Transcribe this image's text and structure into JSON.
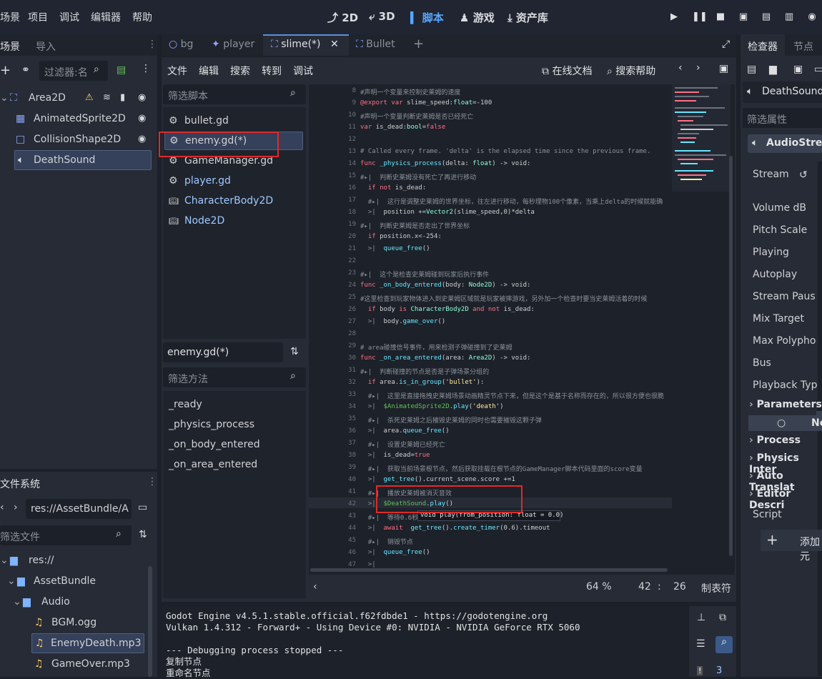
{
  "menubar": {
    "items": [
      "场景",
      "项目",
      "调试",
      "编辑器",
      "帮助"
    ],
    "modes": [
      "2D",
      "3D",
      "脚本",
      "游戏",
      "资产库"
    ]
  },
  "scene_dock": {
    "tabs": [
      "场景",
      "导入"
    ],
    "filter_placeholder": "过滤器:名",
    "nodes": [
      "Area2D",
      "AnimatedSprite2D",
      "CollisionShape2D",
      "DeathSound"
    ]
  },
  "fs_dock": {
    "title": "文件系统",
    "path": "res://AssetBundle/A",
    "filter_placeholder": "筛选文件",
    "items": [
      "res://",
      "AssetBundle",
      "Audio",
      "BGM.ogg",
      "EnemyDeath.mp3",
      "GameOver.mp3"
    ]
  },
  "editor_tabs": [
    "bg",
    "player",
    "slime(*)",
    "Bullet"
  ],
  "script_menu": [
    "文件",
    "编辑",
    "搜索",
    "转到",
    "调试"
  ],
  "script_links": [
    "在线文档",
    "搜索帮助"
  ],
  "script_list": {
    "filter_placeholder": "筛选脚本",
    "items": [
      "bullet.gd",
      "enemy.gd(*)",
      "GameManager.gd",
      "player.gd",
      "CharacterBody2D",
      "Node2D"
    ]
  },
  "method_panel": {
    "current": "enemy.gd(*)",
    "filter_placeholder": "筛选方法",
    "items": [
      "_ready",
      "_physics_process",
      "_on_body_entered",
      "_on_area_entered"
    ]
  },
  "code_lines": [
    {
      "n": "8",
      "t": "#声明一个变量来控制史莱姆的速度"
    },
    {
      "n": "9",
      "t": "@export var slime_speed:float=-100"
    },
    {
      "n": "10",
      "t": "#声明一个变量判断史莱姆是否已经死亡"
    },
    {
      "n": "11",
      "t": "var is_dead:bool=false"
    },
    {
      "n": "12",
      "t": ""
    },
    {
      "n": "13",
      "t": "# Called every frame. 'delta' is the elapsed time since the previous frame."
    },
    {
      "n": "14",
      "t": "func _physics_process(delta: float) -> void:"
    },
    {
      "n": "15",
      "t": "#▸|  判断史莱姆没有死亡了再进行移动"
    },
    {
      "n": "16",
      "t": "  if not is_dead:"
    },
    {
      "n": "17",
      "t": "  #▸|  这行是调整史莱姆的世界坐标，往左进行移动，每秒理物100个像素，当乘上delta的时候就能确"
    },
    {
      "n": "18",
      "t": "  >|  position +=Vector2(slime_speed,0)*delta"
    },
    {
      "n": "19",
      "t": "#▸|  判断史莱姆是否走出了世界坐标"
    },
    {
      "n": "20",
      "t": "  if position.x<-254:"
    },
    {
      "n": "21",
      "t": "  >|  queue_free()"
    },
    {
      "n": "22",
      "t": ""
    },
    {
      "n": "23",
      "t": "#▸|  这个是检查史莱姆碰到玩家后执行事件"
    },
    {
      "n": "24",
      "t": "func _on_body_entered(body: Node2D) -> void:"
    },
    {
      "n": "25",
      "t": "#这里检查到玩家物体进入到史莱姆区域就是玩家被摔游戏，另外加一个检查时要当史莱姆活着的时候"
    },
    {
      "n": "26",
      "t": "  if body is CharacterBody2D and not is_dead:"
    },
    {
      "n": "27",
      "t": "  >|  body.game_over()"
    },
    {
      "n": "28",
      "t": ""
    },
    {
      "n": "29",
      "t": "# area碰撞信号事件，用来检测子弹碰撞到了史莱姆"
    },
    {
      "n": "30",
      "t": "func _on_area_entered(area: Area2D) -> void:"
    },
    {
      "n": "31",
      "t": "#▸|  判断碰撞的节点是否是子弹场景分组的"
    },
    {
      "n": "32",
      "t": "  if area.is_in_group('bullet'):"
    },
    {
      "n": "33",
      "t": "  #▸|  这里是直接拖拽史莱姆场景动画精灵节点下来，但是这个是基于名称而存在的，所以很方便也很脆"
    },
    {
      "n": "34",
      "t": "  >|  $AnimatedSprite2D.play('death')"
    },
    {
      "n": "35",
      "t": "  #▸|  杀死史莱姆之后摧毁史莱姆的同时也需要摧毁这颗子弹"
    },
    {
      "n": "36",
      "t": "  >|  area.queue_free()"
    },
    {
      "n": "37",
      "t": "  #▸|  设置史莱姆已经死亡"
    },
    {
      "n": "38",
      "t": "  >|  is_dead=true"
    },
    {
      "n": "39",
      "t": "  #▸|  获取当前场景根节点，然后获取挂载在根节点的GameManager脚本代码里面的score变量"
    },
    {
      "n": "40",
      "t": "  >|  get_tree().current_scene.score +=1"
    },
    {
      "n": "41",
      "t": "  #▸|  播放史莱姆被消灭音效"
    },
    {
      "n": "42",
      "t": "  >|  $DeathSound.play()"
    },
    {
      "n": "43",
      "t": "  #▸|  等待0.6秒"
    },
    {
      "n": "44",
      "t": "  >|  await  get_tree().create_timer(0.6).timeout"
    },
    {
      "n": "45",
      "t": "  #▸|  销毁节点"
    },
    {
      "n": "46",
      "t": "  >|  queue_free()"
    },
    {
      "n": "47",
      "t": "  >|"
    }
  ],
  "tooltip": "void play(from_position: float = 0.0)",
  "status": {
    "zoom": "64 %",
    "line": "42",
    "col": "26",
    "indent": "制表符"
  },
  "output_lines": [
    "Godot Engine v4.5.1.stable.official.f62fdbde1 - https://godotengine.org",
    "Vulkan 1.4.312 - Forward+ - Using Device #0: NVIDIA - NVIDIA GeForce RTX 5060",
    "",
    "--- Debugging process stopped ---",
    "复制节点",
    "重命名节点"
  ],
  "output_badge": "3",
  "inspector": {
    "tabs": [
      "检查器",
      "节点"
    ],
    "node": "DeathSound",
    "filter_placeholder": "筛选属性",
    "class": "AudioStre",
    "props": [
      "Stream",
      "Volume dB",
      "Pitch Scale",
      "Playing",
      "Autoplay",
      "Stream Paus",
      "Mix Target",
      "Max Polypho",
      "Bus",
      "Playback Typ"
    ],
    "sections": [
      "Parameters",
      "No",
      "Process",
      "Physics Inter",
      "Auto Translat",
      "Editor Descri"
    ],
    "script_label": "Script",
    "add_label": "添加元"
  }
}
